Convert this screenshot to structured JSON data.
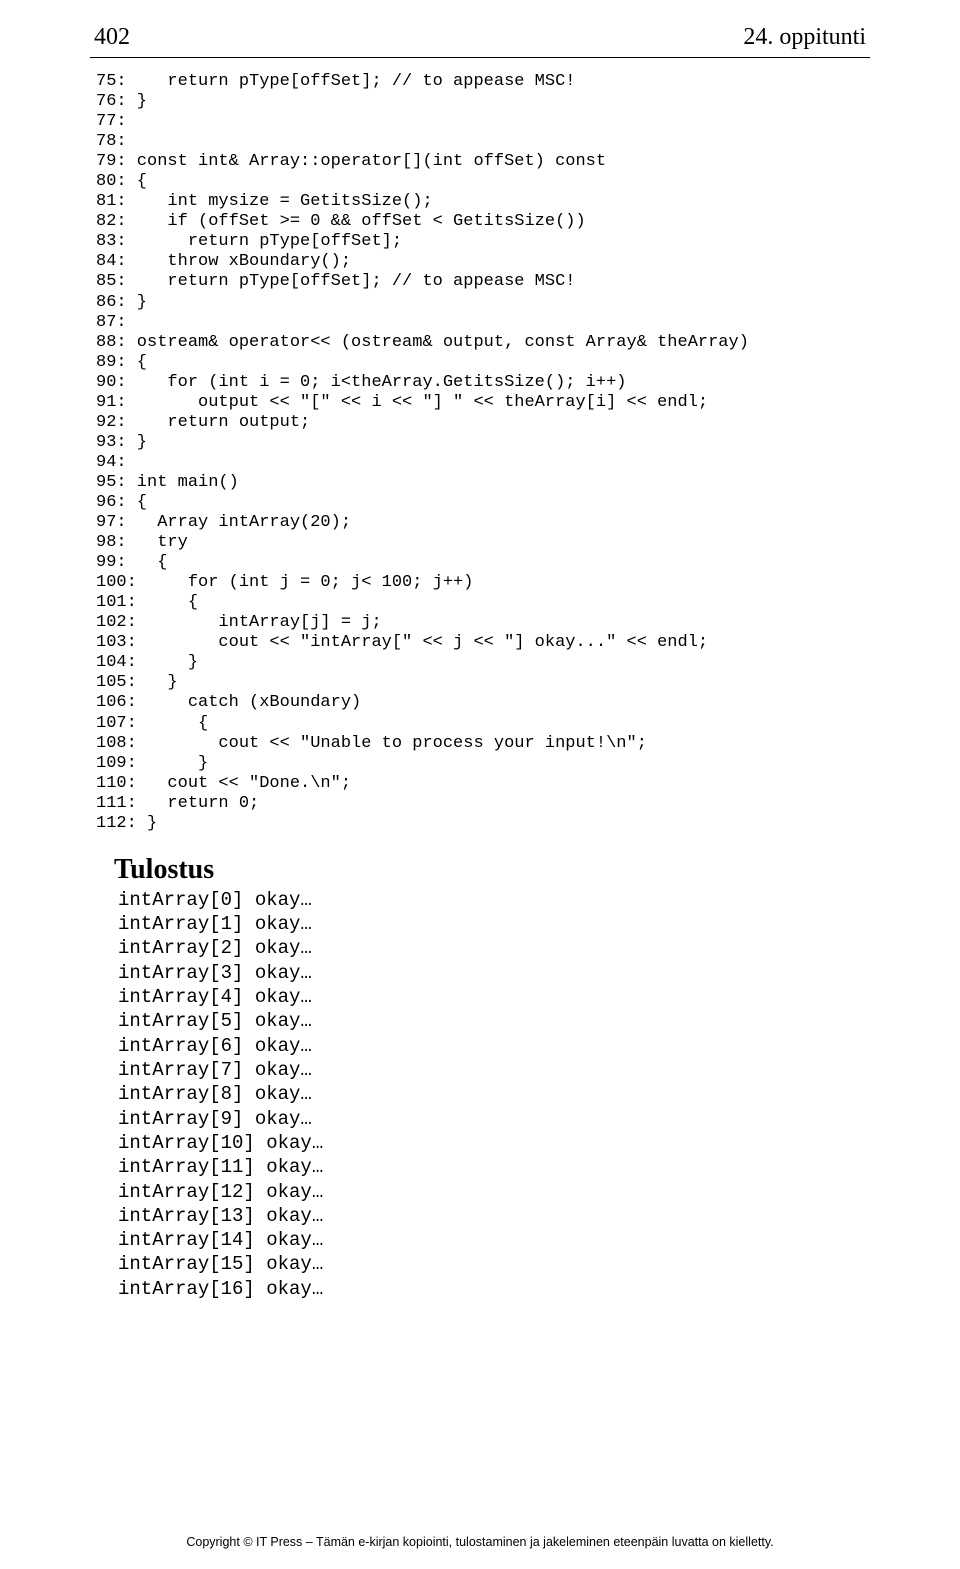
{
  "header": {
    "page_number": "402",
    "chapter_title": "24. oppitunti"
  },
  "code": {
    "lines": [
      "75:    return pType[offSet]; // to appease MSC!",
      "76: }",
      "77:",
      "78:",
      "79: const int& Array::operator[](int offSet) const",
      "80: {",
      "81:    int mysize = GetitsSize();",
      "82:    if (offSet >= 0 && offSet < GetitsSize())",
      "83:      return pType[offSet];",
      "84:    throw xBoundary();",
      "85:    return pType[offSet]; // to appease MSC!",
      "86: }",
      "87:",
      "88: ostream& operator<< (ostream& output, const Array& theArray)",
      "89: {",
      "90:    for (int i = 0; i<theArray.GetitsSize(); i++)",
      "91:       output << \"[\" << i << \"] \" << theArray[i] << endl;",
      "92:    return output;",
      "93: }",
      "94:",
      "95: int main()",
      "96: {",
      "97:   Array intArray(20);",
      "98:   try",
      "99:   {",
      "100:     for (int j = 0; j< 100; j++)",
      "101:     {",
      "102:        intArray[j] = j;",
      "103:        cout << \"intArray[\" << j << \"] okay...\" << endl;",
      "104:     }",
      "105:   }",
      "106:     catch (xBoundary)",
      "107:      {",
      "108:        cout << \"Unable to process your input!\\n\";",
      "109:      }",
      "110:   cout << \"Done.\\n\";",
      "111:   return 0;",
      "112: }"
    ]
  },
  "output": {
    "heading": "Tulostus",
    "lines": [
      "intArray[0] okay…",
      "intArray[1] okay…",
      "intArray[2] okay…",
      "intArray[3] okay…",
      "intArray[4] okay…",
      "intArray[5] okay…",
      "intArray[6] okay…",
      "intArray[7] okay…",
      "intArray[8] okay…",
      "intArray[9] okay…",
      "intArray[10] okay…",
      "intArray[11] okay…",
      "intArray[12] okay…",
      "intArray[13] okay…",
      "intArray[14] okay…",
      "intArray[15] okay…",
      "intArray[16] okay…"
    ]
  },
  "footer": {
    "text": "Copyright © IT Press – Tämän e-kirjan kopiointi, tulostaminen ja jakeleminen eteenpäin luvatta on kielletty."
  }
}
